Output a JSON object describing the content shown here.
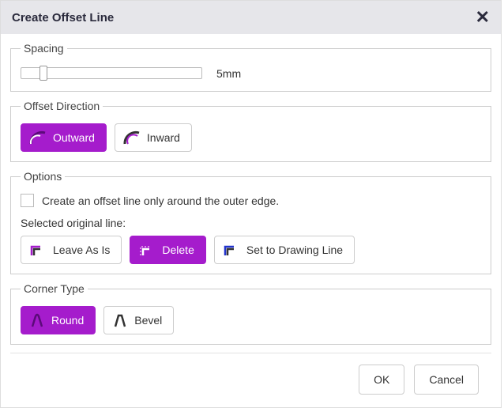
{
  "title": "Create Offset Line",
  "spacing": {
    "legend": "Spacing",
    "value_label": "5mm"
  },
  "direction": {
    "legend": "Offset Direction",
    "outward": "Outward",
    "inward": "Inward"
  },
  "options": {
    "legend": "Options",
    "outer_edge": "Create an offset line only around the outer edge.",
    "selected_label": "Selected original line:",
    "leave": "Leave As Is",
    "delete": "Delete",
    "drawing": "Set to Drawing Line"
  },
  "corner": {
    "legend": "Corner Type",
    "round": "Round",
    "bevel": "Bevel"
  },
  "footer": {
    "ok": "OK",
    "cancel": "Cancel"
  }
}
